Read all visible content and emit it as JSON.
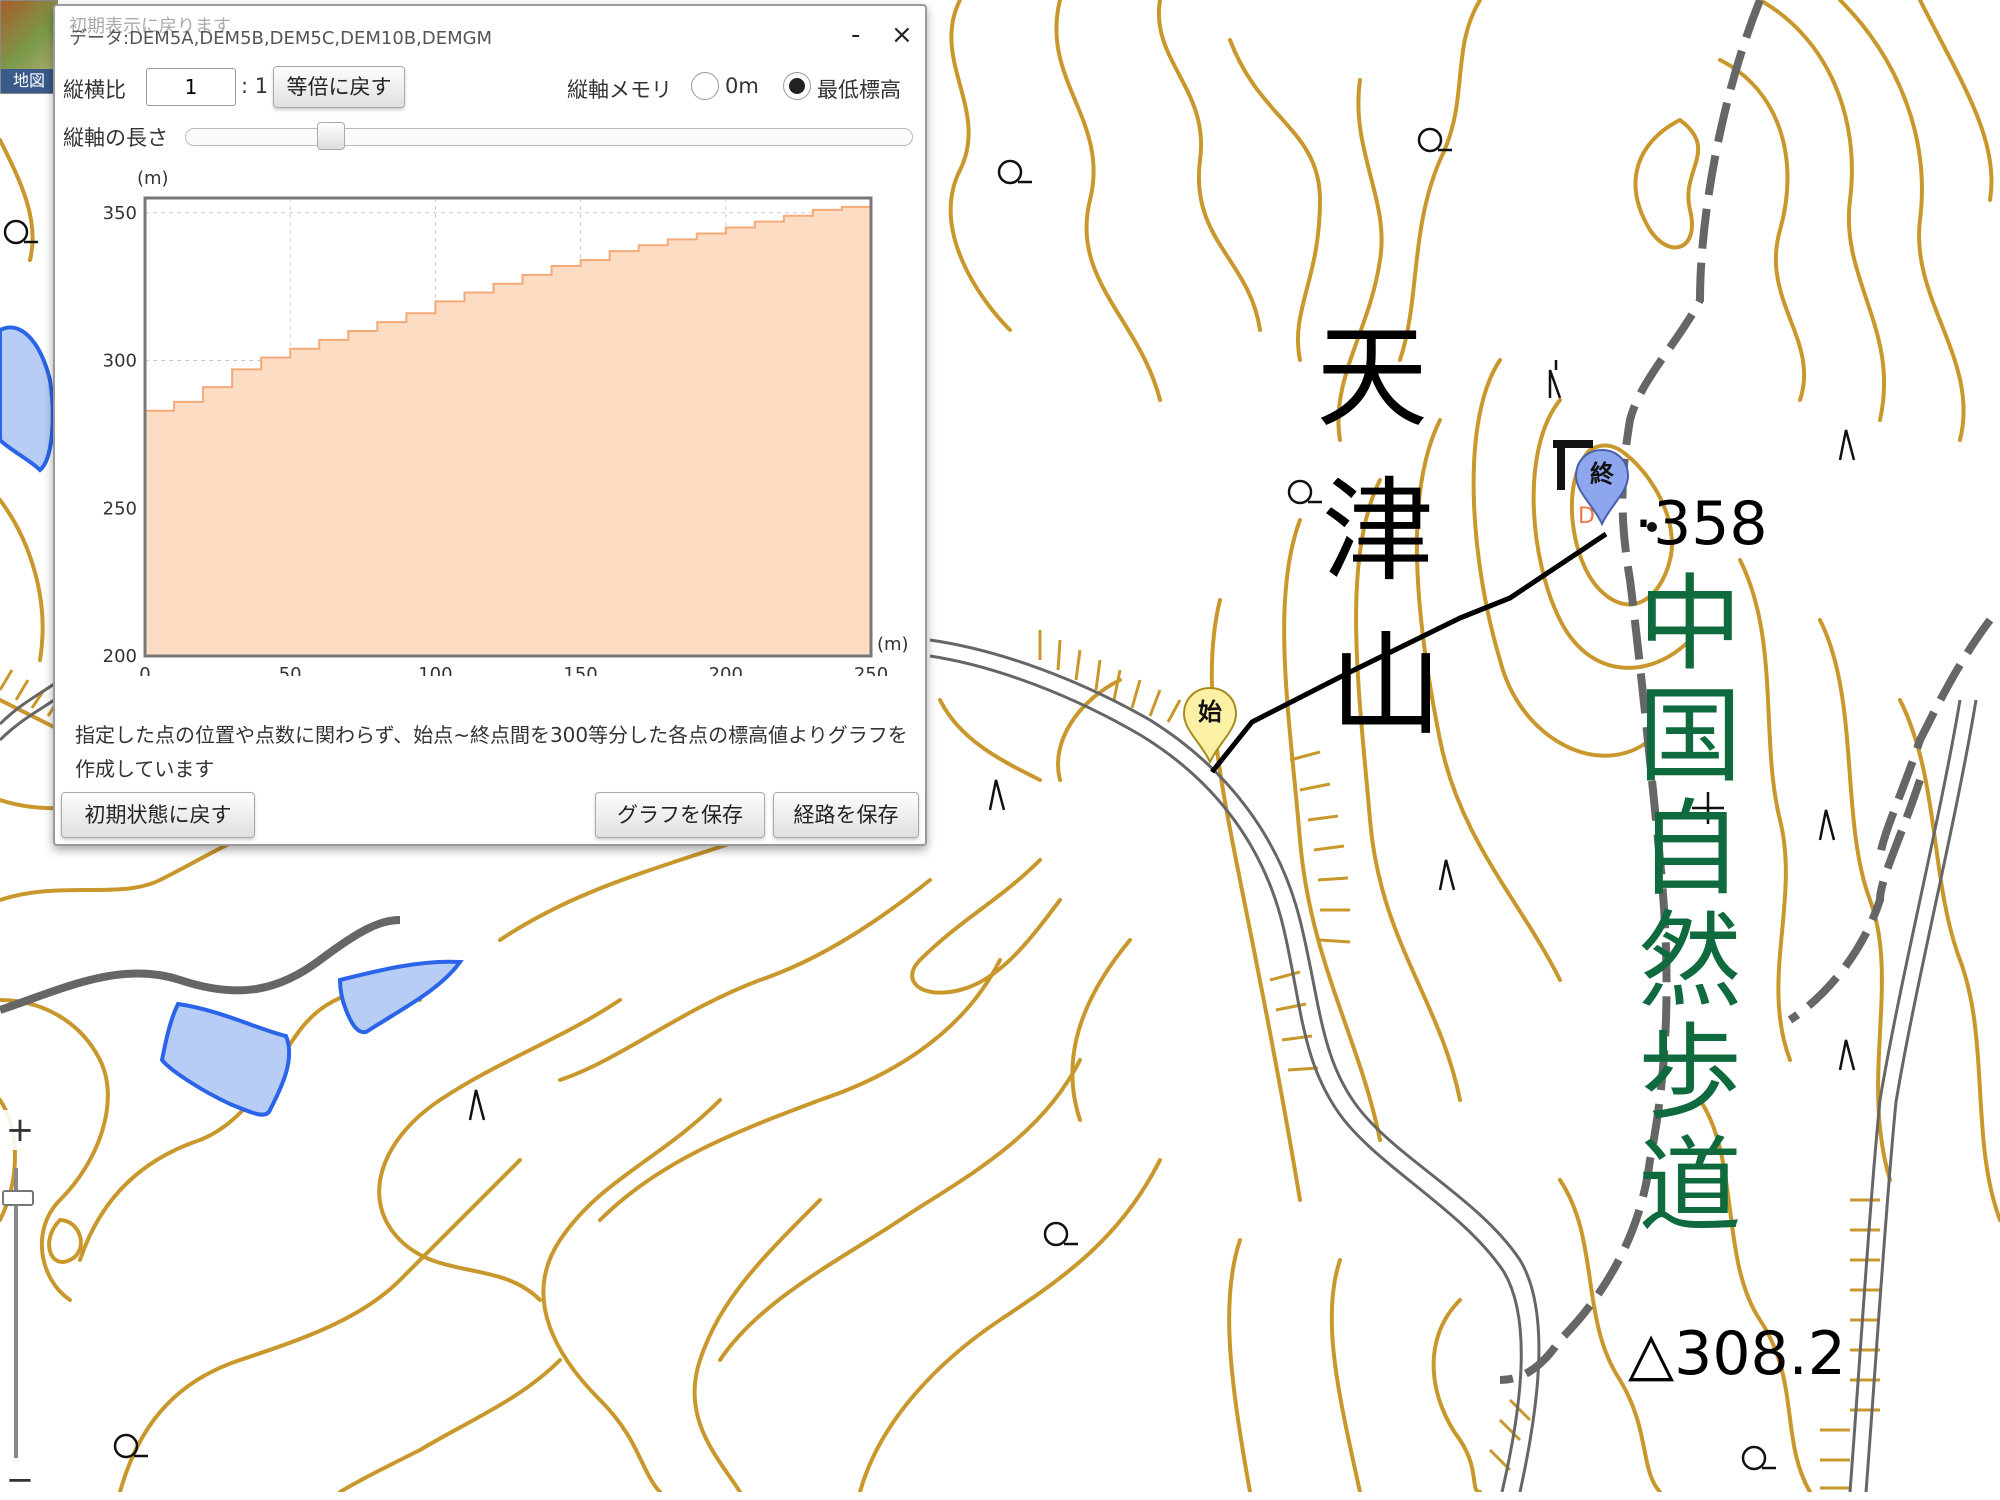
{
  "map": {
    "mountain_name_chars": [
      "天",
      "津",
      "山"
    ],
    "peak_elevation": "·358",
    "triangulation_point": "△308.2",
    "trail_name": "中国自然歩道",
    "start_marker": "始",
    "end_marker": "終",
    "layer_button": "地図",
    "contour_color": "#c9982c",
    "water_fill": "#b8cdf5",
    "water_stroke": "#2a64e8",
    "road_color": "#666666",
    "trail_color": "#0f6a3e"
  },
  "zoom": {
    "in_label": "+",
    "out_label": "−"
  },
  "dialog": {
    "title_ghost": "初期表示に戻ります",
    "title": "データ:DEM5A,DEM5B,DEM5C,DEM10B,DEMGM",
    "minimize_label": "-",
    "close_label": "×",
    "aspect_label": "縦横比",
    "aspect_value": "1",
    "aspect_suffix": ": 1",
    "reset_scale_button": "等倍に戻す",
    "axis_label": "縦軸メモリ",
    "radio_zero_label": "0m",
    "radio_min_label": "最低標高",
    "radio_selected": "最低標高",
    "axis_length_label": "縦軸の長さ",
    "note": "指定した点の位置や点数に関わらず、始点~終点間を300等分した各点の標高値よりグラフを作成しています",
    "reset_button": "初期状態に戻す",
    "save_graph_button": "グラフを保存",
    "save_route_button": "経路を保存"
  },
  "chart_data": {
    "type": "area",
    "xlabel": "(m)",
    "ylabel": "(m)",
    "xlim": [
      0,
      250
    ],
    "ylim": [
      200,
      355
    ],
    "xticks": [
      0,
      50,
      100,
      150,
      200,
      250
    ],
    "yticks": [
      200,
      250,
      300,
      350
    ],
    "grid": true,
    "fill_color": "#fddcc4",
    "line_color": "#f4a97a",
    "x": [
      0,
      10,
      20,
      30,
      40,
      50,
      60,
      70,
      80,
      90,
      100,
      110,
      120,
      130,
      140,
      150,
      160,
      170,
      180,
      190,
      200,
      210,
      220,
      230,
      240,
      250
    ],
    "y": [
      283,
      286,
      291,
      297,
      301,
      304,
      307,
      310,
      313,
      316,
      320,
      323,
      326,
      329,
      332,
      334,
      337,
      339,
      341,
      343,
      345,
      347,
      349,
      351,
      352,
      354
    ]
  }
}
